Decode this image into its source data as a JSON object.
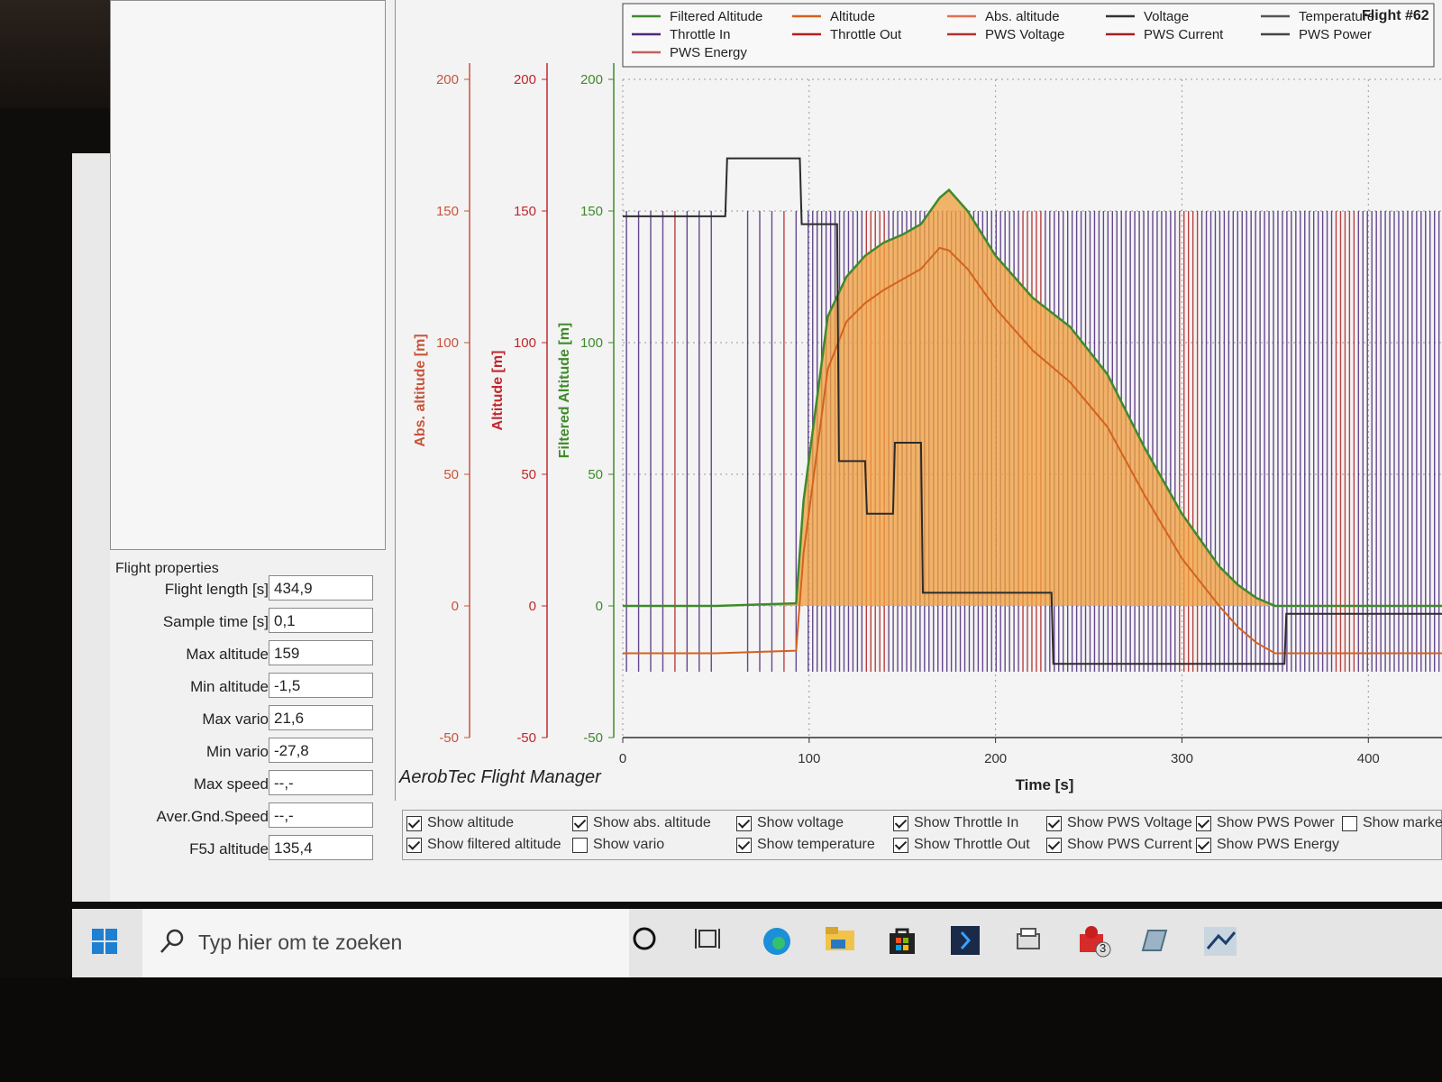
{
  "window": {
    "app_title": "AerobTec Flight Manager"
  },
  "properties": {
    "title": "Flight properties",
    "rows": [
      {
        "label": "Flight length [s]",
        "value": "434,9"
      },
      {
        "label": "Sample time [s]",
        "value": "0,1"
      },
      {
        "label": "Max altitude",
        "value": "159"
      },
      {
        "label": "Min altitude",
        "value": "-1,5"
      },
      {
        "label": "Max vario",
        "value": "21,6"
      },
      {
        "label": "Min vario",
        "value": "-27,8"
      },
      {
        "label": "Max speed",
        "value": "--,-"
      },
      {
        "label": "Aver.Gnd.Speed",
        "value": "--,-"
      },
      {
        "label": "F5J altitude",
        "value": "135,4"
      }
    ]
  },
  "checkboxes": [
    {
      "label": "Show altitude",
      "checked": true
    },
    {
      "label": "Show filtered altitude",
      "checked": true
    },
    {
      "label": "Show abs. altitude",
      "checked": true
    },
    {
      "label": "Show vario",
      "checked": false
    },
    {
      "label": "Show voltage",
      "checked": true
    },
    {
      "label": "Show temperature",
      "checked": true
    },
    {
      "label": "Show Throttle In",
      "checked": true
    },
    {
      "label": "Show Throttle Out",
      "checked": true
    },
    {
      "label": "Show PWS Voltage",
      "checked": true
    },
    {
      "label": "Show PWS Current",
      "checked": true
    },
    {
      "label": "Show PWS Power",
      "checked": true
    },
    {
      "label": "Show PWS Energy",
      "checked": true
    },
    {
      "label": "Show markers",
      "checked": false
    }
  ],
  "taskbar": {
    "search_placeholder": "Typ hier om te zoeken",
    "badge": "3"
  },
  "colors": {
    "filtered": "#3f8a2a",
    "altitude": "#d4621e",
    "abs": "#e07050",
    "throttle_in": "#4b2a7a",
    "throttle_out": "#b02020",
    "fill": "#f0a040"
  },
  "chart_data": {
    "type": "line",
    "title": "Flight #62",
    "xlabel": "Time [s]",
    "xlim": [
      0,
      440
    ],
    "x_ticks": [
      "0",
      "100",
      "200",
      "300",
      "400"
    ],
    "axes": [
      {
        "label": "Abs. altitude [m]",
        "ticks": [
          "200",
          "150",
          "100",
          "50",
          "0",
          "-50"
        ],
        "ylim": [
          -50,
          200
        ]
      },
      {
        "label": "Altitude [m]",
        "ticks": [
          "200",
          "150",
          "100",
          "50",
          "0",
          "-50"
        ],
        "ylim": [
          -50,
          200
        ]
      },
      {
        "label": "Filtered Altitude [m]",
        "ticks": [
          "200",
          "150",
          "100",
          "50",
          "0",
          "-50"
        ],
        "ylim": [
          -50,
          200
        ]
      }
    ],
    "legend": [
      "Filtered Altitude",
      "Altitude",
      "Abs. altitude",
      "Voltage",
      "Temperature",
      "Throttle In",
      "Throttle Out",
      "PWS Voltage",
      "PWS Current",
      "PWS Power",
      "PWS Energy"
    ],
    "series": [
      {
        "name": "Filtered Altitude",
        "x": [
          0,
          50,
          93,
          97,
          110,
          120,
          130,
          140,
          150,
          160,
          170,
          175,
          185,
          200,
          220,
          240,
          260,
          280,
          300,
          320,
          330,
          340,
          350,
          420,
          440
        ],
        "values": [
          0,
          0,
          1,
          40,
          110,
          125,
          133,
          138,
          141,
          145,
          155,
          158,
          150,
          133,
          117,
          106,
          88,
          60,
          35,
          15,
          8,
          3,
          0,
          0,
          0
        ]
      },
      {
        "name": "Altitude",
        "x": [
          0,
          50,
          93,
          97,
          110,
          120,
          130,
          140,
          150,
          160,
          170,
          175,
          185,
          200,
          220,
          240,
          260,
          280,
          300,
          320,
          330,
          340,
          350,
          420,
          440
        ],
        "values": [
          -18,
          -18,
          -17,
          20,
          90,
          108,
          115,
          120,
          124,
          128,
          136,
          135,
          128,
          113,
          97,
          85,
          68,
          42,
          18,
          0,
          -8,
          -14,
          -18,
          -18,
          -18
        ]
      },
      {
        "name": "Throttle Out",
        "x": [
          0,
          55,
          56,
          95,
          96,
          115,
          116,
          130,
          131,
          145,
          146,
          160,
          161,
          230,
          231,
          355,
          356,
          440
        ],
        "values": [
          148,
          148,
          170,
          170,
          145,
          145,
          55,
          55,
          35,
          35,
          62,
          62,
          5,
          5,
          -22,
          -22,
          -3,
          -3
        ]
      }
    ]
  }
}
